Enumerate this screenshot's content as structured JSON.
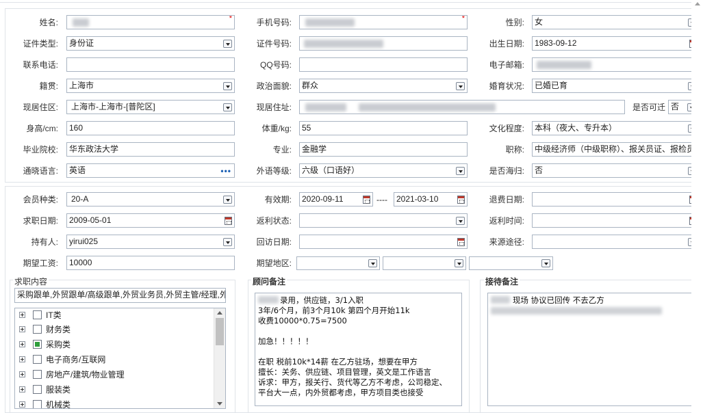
{
  "form": {
    "name": {
      "label": "姓名:",
      "required_mark": "*"
    },
    "mobile": {
      "label": "手机号码:",
      "required_mark": "*"
    },
    "gender": {
      "label": "性别:",
      "value": "女"
    },
    "id_type": {
      "label": "证件类型:",
      "value": "身份证"
    },
    "id_number": {
      "label": "证件号码:"
    },
    "birth_date": {
      "label": "出生日期:",
      "value": "1983-09-12"
    },
    "phone": {
      "label": "联系电话:",
      "value": ""
    },
    "qq": {
      "label": "QQ号码:",
      "value": ""
    },
    "email": {
      "label": "电子邮箱:"
    },
    "native_place": {
      "label": "籍贯:",
      "value": "上海市"
    },
    "political_status": {
      "label": "政治面貌:",
      "value": "群众"
    },
    "marital_status": {
      "label": "婚育状况:",
      "value": "已婚已育"
    },
    "current_area": {
      "label": "现居住区:",
      "value": "上海市-上海市-[普陀区]"
    },
    "current_address": {
      "label": "现居住址:"
    },
    "relocate": {
      "label": "是否可迁",
      "value": "否"
    },
    "height": {
      "label": "身高/cm:",
      "value": "160"
    },
    "weight": {
      "label": "体重/kg:",
      "value": "55"
    },
    "education": {
      "label": "文化程度:",
      "value": "本科（夜大、专升本）"
    },
    "school": {
      "label": "毕业院校:",
      "value": "华东政法大学"
    },
    "major": {
      "label": "专业:",
      "value": "金融学"
    },
    "title": {
      "label": "职称:",
      "value": "中级经济师（中级职称）、报关员证、报检员"
    },
    "language": {
      "label": "通晓语言:",
      "value": "英语"
    },
    "foreign_level": {
      "label": "外语等级:",
      "value": "六级（口语好）"
    },
    "returnee": {
      "label": "是否海归:",
      "value": "否"
    }
  },
  "membership": {
    "member_type": {
      "label": "会员种类:",
      "value": "20-A"
    },
    "validity": {
      "label": "有效期:",
      "start": "2020-09-11",
      "separator": "----",
      "end": "2021-03-10"
    },
    "refund_date": {
      "label": "退费日期:",
      "value": ""
    },
    "job_seek_date": {
      "label": "求职日期:",
      "value": "2009-05-01"
    },
    "rebate_status": {
      "label": "返利状态:",
      "value": ""
    },
    "rebate_time": {
      "label": "返利时间:",
      "value": ""
    },
    "holder": {
      "label": "持有人:",
      "value": "yirui025"
    },
    "revisit_date": {
      "label": "回访日期:",
      "value": ""
    },
    "source": {
      "label": "来源途径:",
      "value": ""
    },
    "expected_salary": {
      "label": "期望工资:",
      "value": "10000"
    },
    "expected_area": {
      "label": "期望地区:"
    }
  },
  "job_content": {
    "title": "求职内容",
    "summary": "采购跟单,外贸跟单/高级跟单,外贸业务员,外贸主管/经理,外",
    "categories": [
      {
        "label": "IT类",
        "checked": false
      },
      {
        "label": "财务类",
        "checked": false
      },
      {
        "label": "采购类",
        "checked": true
      },
      {
        "label": "电子商务/互联网",
        "checked": false
      },
      {
        "label": "房地产/建筑/物业管理",
        "checked": false
      },
      {
        "label": "服装类",
        "checked": false
      },
      {
        "label": "机械类",
        "checked": false
      }
    ]
  },
  "advisor_notes": {
    "title": "顾问备注",
    "lines": [
      "录用，供应链，3/1入职",
      "3年/6个月，前3个月10k 第四个月开始11k",
      "收费10000*0.75=7500",
      "",
      "加急！！！！！",
      "",
      "在职 税前10k*14薪 在乙方驻场，想要在甲方",
      "擅长：关务、供应链、项目管理，英文是工作语言",
      "诉求：甲方，报关行、货代等乙方不考虑，公司稳定、",
      "平台大一点，内外贸都考虑，甲方项目类也接受"
    ]
  },
  "reception_notes": {
    "title": "接待备注",
    "line1": "现场 协议已回传   不去乙方"
  }
}
